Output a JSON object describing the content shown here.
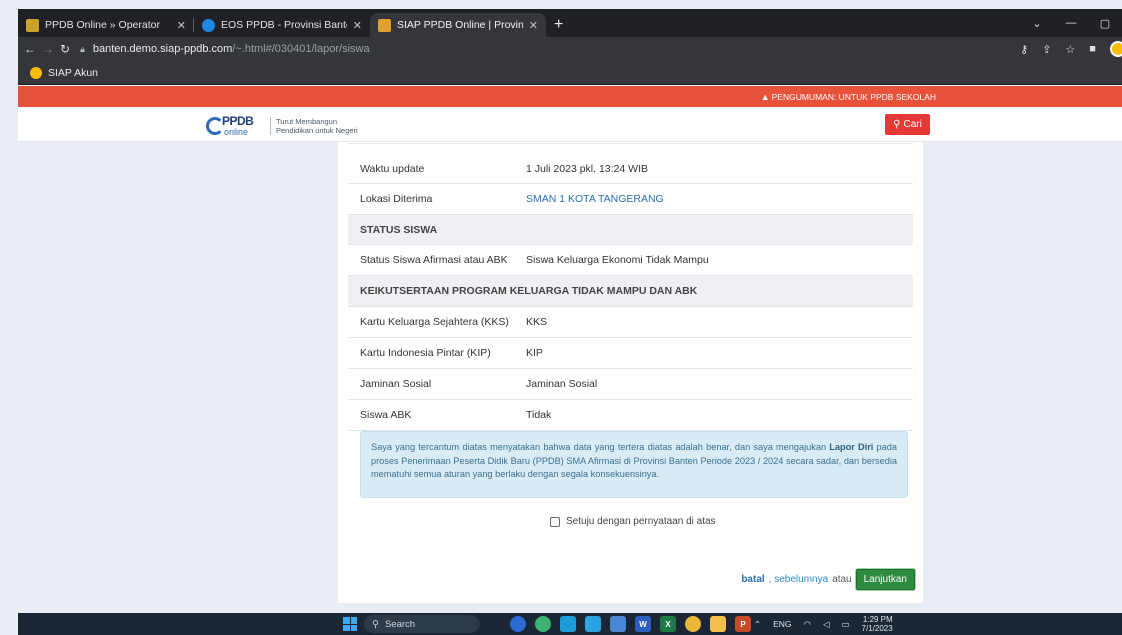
{
  "browser": {
    "tabs": [
      {
        "title": "PPDB Online » Operator",
        "favicon_color": "#c9a227"
      },
      {
        "title": "EOS PPDB - Provinsi Banten",
        "favicon_color": "#1e88e5"
      },
      {
        "title": "SIAP PPDB Online | Provinsi Bant",
        "favicon_color": "#e0a030"
      }
    ],
    "url_host": "banten.demo.siap-ppdb.com",
    "url_path": "/~.html#/030401/lapor/siswa",
    "bookmark": "SIAP Akun"
  },
  "site": {
    "announcement": "PENGUMUMAN: UNTUK PPDB SEKOLAH",
    "logo_ppdb": "PPDB",
    "logo_online": "online",
    "tagline_1": "Turut Membangun",
    "tagline_2": "Pendidikan untuk Negeri",
    "search_label": "Cari"
  },
  "details": {
    "waktu_update": {
      "label": "Waktu update",
      "value": "1 Juli 2023 pkl. 13:24 WIB"
    },
    "lokasi": {
      "label": "Lokasi Diterima",
      "value": "SMAN 1 KOTA TANGERANG"
    },
    "status_heading": "STATUS SISWA",
    "status_afirmasi": {
      "label": "Status Siswa Afirmasi atau ABK",
      "value": "Siswa Keluarga Ekonomi Tidak Mampu"
    },
    "program_heading": "KEIKUTSERTAAN PROGRAM KELUARGA TIDAK MAMPU DAN ABK",
    "kks": {
      "label": "Kartu Keluarga Sejahtera (KKS)",
      "value": "KKS"
    },
    "kip": {
      "label": "Kartu Indonesia Pintar (KIP)",
      "value": "KIP"
    },
    "jamsos": {
      "label": "Jaminan Sosial",
      "value": "Jaminan Sosial"
    },
    "abk": {
      "label": "Siswa ABK",
      "value": "Tidak"
    }
  },
  "notice": {
    "part1": "Saya yang tercantum diatas menyatakan bahwa data yang tertera diatas adalah benar, dan saya mengajukan ",
    "bold": "Lapor Diri",
    "part2": " pada proses Penerimaan Peserta Didik Baru (PPDB) SMA Afirmasi di Provinsi Banten Periode 2023 / 2024 secara sadar, dan bersedia mematuhi semua aturan yang berlaku dengan segala konsekuensinya."
  },
  "agreement_label": "Setuju dengan pernyataan di atas",
  "actions": {
    "batal": "batal",
    "sebelumnya": ", sebelumnya",
    "atau": "atau",
    "lanjutkan": "Lanjutkan"
  },
  "taskbar": {
    "search": "Search",
    "lang": "ENG",
    "time": "1:29 PM",
    "date": "7/1/2023"
  }
}
